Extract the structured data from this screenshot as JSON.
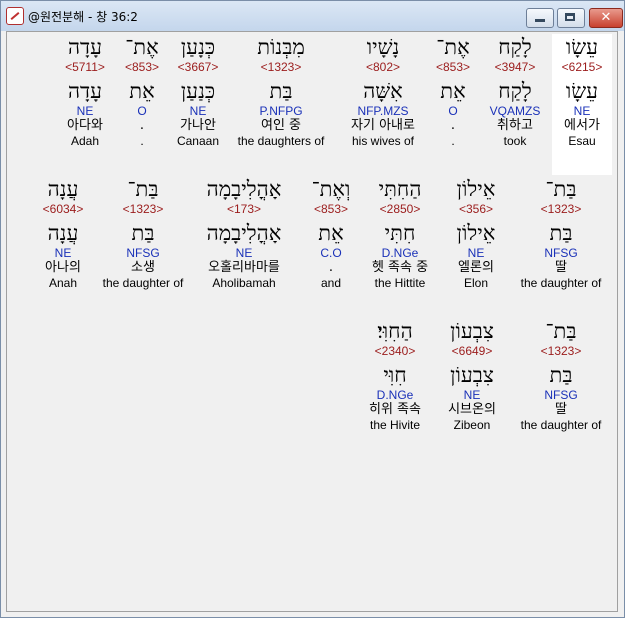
{
  "window": {
    "title": "@원전분해 - 창 36:2",
    "buttons": {
      "minimize": "_",
      "maximize": "□",
      "close": "✕"
    },
    "icon": "app-icon"
  },
  "lines": [
    {
      "words": [
        {
          "heb": "עֵשָׂו",
          "num": "<6215>",
          "lex": "עֵשָׂו",
          "morph": "NE",
          "kor": "에서가",
          "eng": "Esau",
          "selected": true
        },
        {
          "heb": "לָקַח",
          "num": "<3947>",
          "lex": "לָקַח",
          "morph": "VQAMZS",
          "kor": "취하고",
          "eng": "took"
        },
        {
          "heb": "אֶת־",
          "num": "<853>",
          "lex": "אֵת",
          "morph": "O",
          "kor": ".",
          "eng": "."
        },
        {
          "heb": "נָשָׁיו",
          "num": "<802>",
          "lex": "אִשָּׁה",
          "morph": "NFP.MZS",
          "kor": "자기 아내로",
          "eng": "his wives of"
        },
        {
          "heb": "מִבְּנוֹת",
          "num": "<1323>",
          "lex": "בַּת",
          "morph": "P.NFPG",
          "kor": "여인 중",
          "eng": "the daughters of"
        },
        {
          "heb": "כְּנָעַן",
          "num": "<3667>",
          "lex": "כְּנַעַן",
          "morph": "NE",
          "kor": "가나안",
          "eng": "Canaan"
        },
        {
          "heb": "אֶת־",
          "num": "<853>",
          "lex": "אֵת",
          "morph": "O",
          "kor": ".",
          "eng": "."
        },
        {
          "heb": "עָדָה",
          "num": "<5711>",
          "lex": "עָדָה",
          "morph": "NE",
          "kor": "아다와",
          "eng": "Adah"
        }
      ]
    },
    {
      "words": [
        {
          "heb": "בַּת־",
          "num": "<1323>",
          "lex": "בַּת",
          "morph": "NFSG",
          "kor": "딸",
          "eng": "the daughter of"
        },
        {
          "heb": "אֵילוֹן",
          "num": "<356>",
          "lex": "אֵילוֹן",
          "morph": "NE",
          "kor": "엘론의",
          "eng": "Elon"
        },
        {
          "heb": "הַחִתִּי",
          "num": "<2850>",
          "lex": "חִתִּי",
          "morph": "D.NGe",
          "kor": "헷 족속 중",
          "eng": "the Hittite"
        },
        {
          "heb": "וְאֶת־",
          "num": "<853>",
          "lex": "אֵת",
          "morph": "C.O",
          "kor": ".",
          "eng": "and"
        },
        {
          "heb": "אָהֳלִיבָמָה",
          "num": "<173>",
          "lex": "אָהֳלִיבָמָה",
          "morph": "NE",
          "kor": "오홀리바마를",
          "eng": "Aholibamah"
        },
        {
          "heb": "בַּת־",
          "num": "<1323>",
          "lex": "בַּת",
          "morph": "NFSG",
          "kor": "소생",
          "eng": "the daughter of"
        },
        {
          "heb": "עֲנָה",
          "num": "<6034>",
          "lex": "עֲנָה",
          "morph": "NE",
          "kor": "아나의",
          "eng": "Anah"
        }
      ]
    },
    {
      "words": [
        {
          "heb": "בַּת־",
          "num": "<1323>",
          "lex": "בַּת",
          "morph": "NFSG",
          "kor": "딸",
          "eng": "the daughter of"
        },
        {
          "heb": "צִבְעוֹן",
          "num": "<6649>",
          "lex": "צִבְעוֹן",
          "morph": "NE",
          "kor": "시브온의",
          "eng": "Zibeon"
        },
        {
          "heb": "הַחִוִּי׃",
          "num": "<2340>",
          "lex": "חִוִּי",
          "morph": "D.NGe",
          "kor": "히위 족속",
          "eng": "the Hivite"
        }
      ]
    }
  ]
}
